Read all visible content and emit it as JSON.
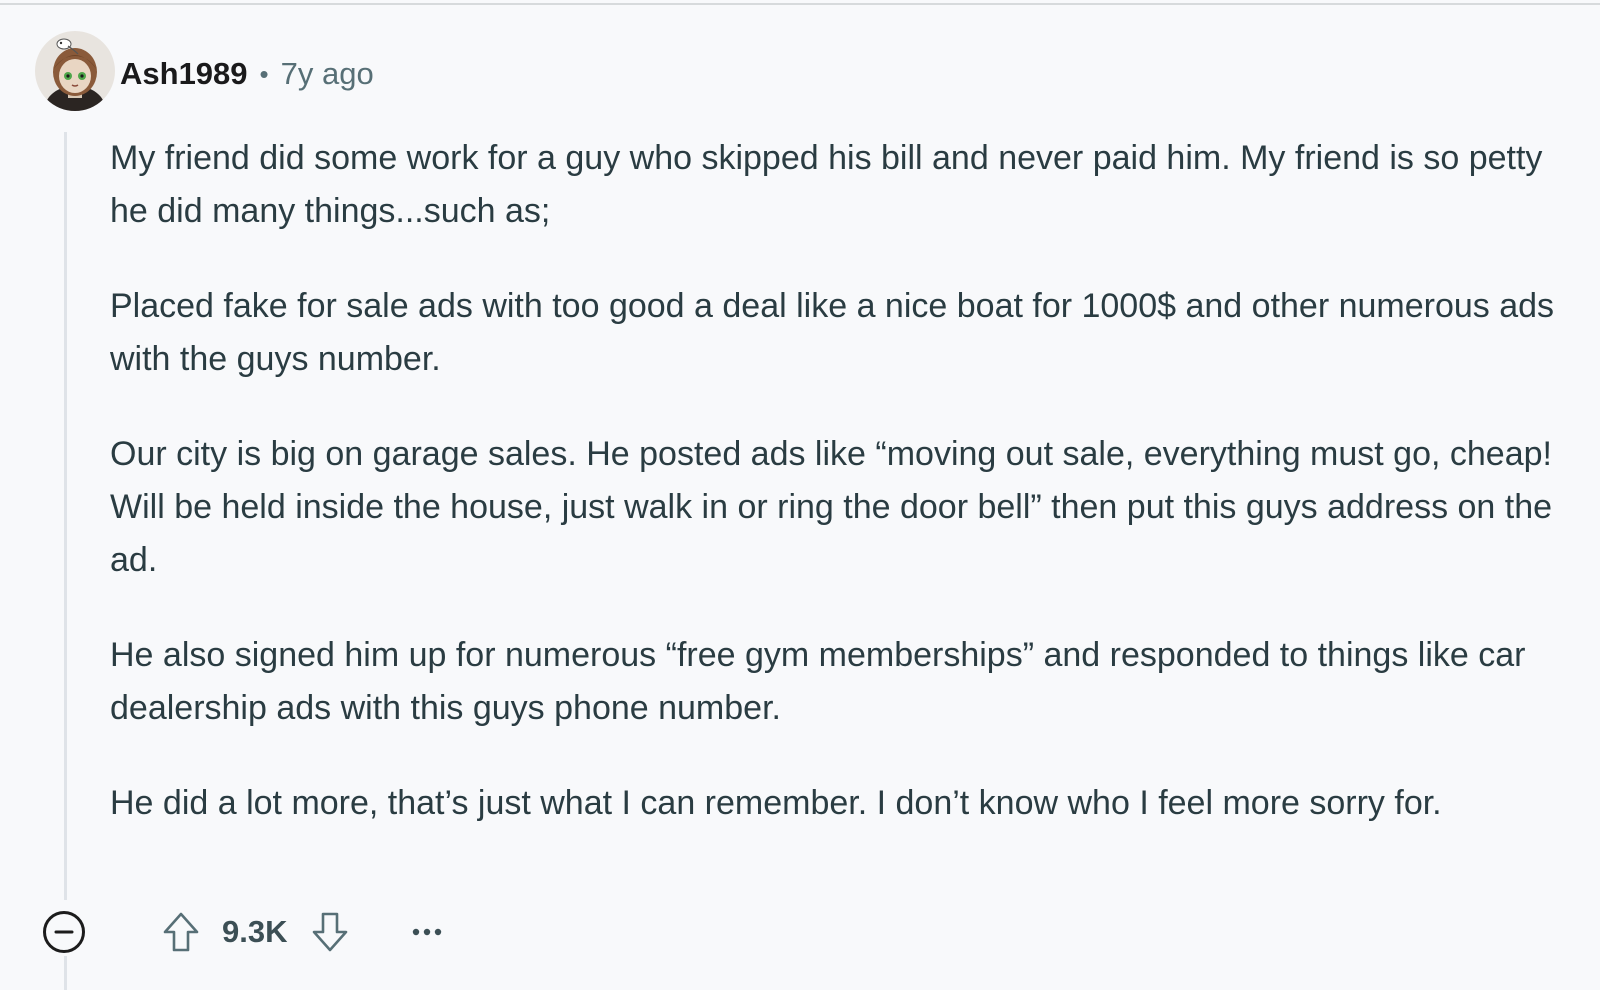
{
  "comment": {
    "username": "Ash1989",
    "separator": "•",
    "time": "7y ago",
    "paragraphs": [
      "My friend did some work for a guy who skipped his bill and never paid him. My friend is so petty he did many things...such as;",
      "Placed fake for sale ads with too good a deal like a nice boat for 1000$ and other numerous ads with the guys number.",
      "Our city is big on garage sales. He posted ads like “moving out sale, everything must go, cheap! Will be held inside the house, just walk in or ring the door bell” then put this guys address on the ad.",
      "He also signed him up for numerous “free gym memberships” and responded to things like car dealership ads with this guys phone number.",
      "He did a lot more, that’s just what I can remember. I don’t know who I feel more sorry for."
    ],
    "score": "9.3K"
  },
  "icons": {
    "collapse": "minus-circle-icon",
    "upvote": "arrow-up-icon",
    "downvote": "arrow-down-icon",
    "more": "ellipsis-icon"
  },
  "colors": {
    "background": "#f8f9fb",
    "text": "#2a3c42",
    "muted": "#576f76",
    "thread_line": "#dfe3e8"
  }
}
